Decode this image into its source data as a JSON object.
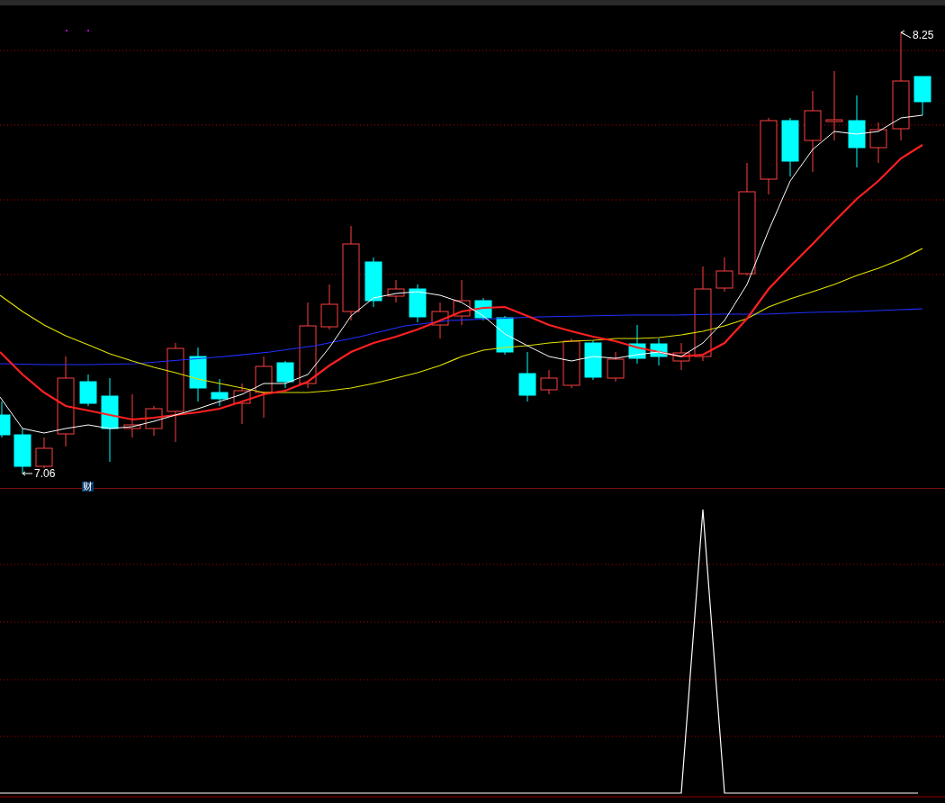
{
  "price_chart": {
    "high_label": "8.25",
    "low_label": "7.06",
    "event_marker": "财"
  }
}
